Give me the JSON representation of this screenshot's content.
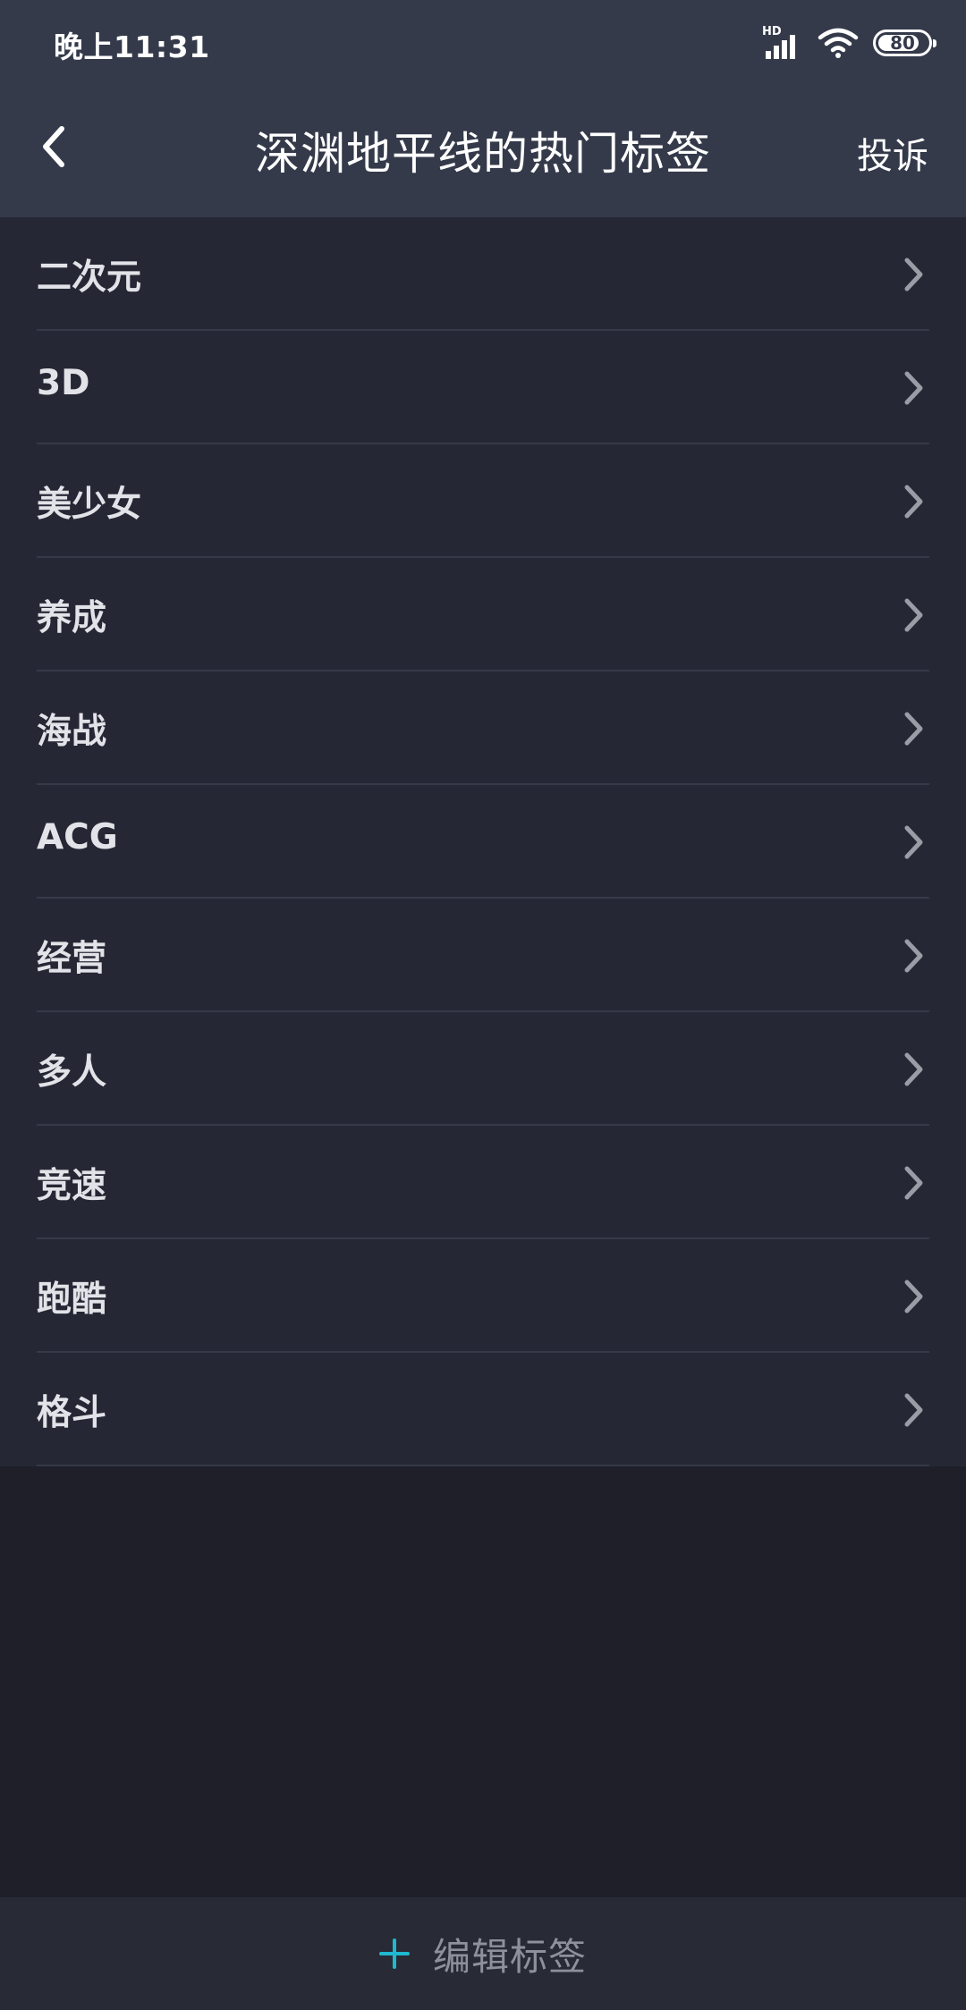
{
  "status_bar": {
    "time": "晚上11:31",
    "network_label": "HD",
    "battery_level": "80"
  },
  "nav": {
    "title": "深渊地平线的热门标签",
    "complain_label": "投诉"
  },
  "tags": [
    {
      "label": "二次元"
    },
    {
      "label": "3D"
    },
    {
      "label": "美少女"
    },
    {
      "label": "养成"
    },
    {
      "label": "海战"
    },
    {
      "label": "ACG"
    },
    {
      "label": "经营"
    },
    {
      "label": "多人"
    },
    {
      "label": "竞速"
    },
    {
      "label": "跑酷"
    },
    {
      "label": "格斗"
    }
  ],
  "footer": {
    "edit_label": "编辑标签"
  },
  "colors": {
    "header_bg": "#343a4a",
    "list_bg": "#252734",
    "page_bg": "#1e1f28",
    "accent": "#1fb8cf"
  },
  "icons": {
    "back": "chevron-left-icon",
    "row": "chevron-right-icon",
    "add": "plus-icon",
    "wifi": "wifi-icon",
    "signal": "signal-icon",
    "battery": "battery-icon"
  }
}
